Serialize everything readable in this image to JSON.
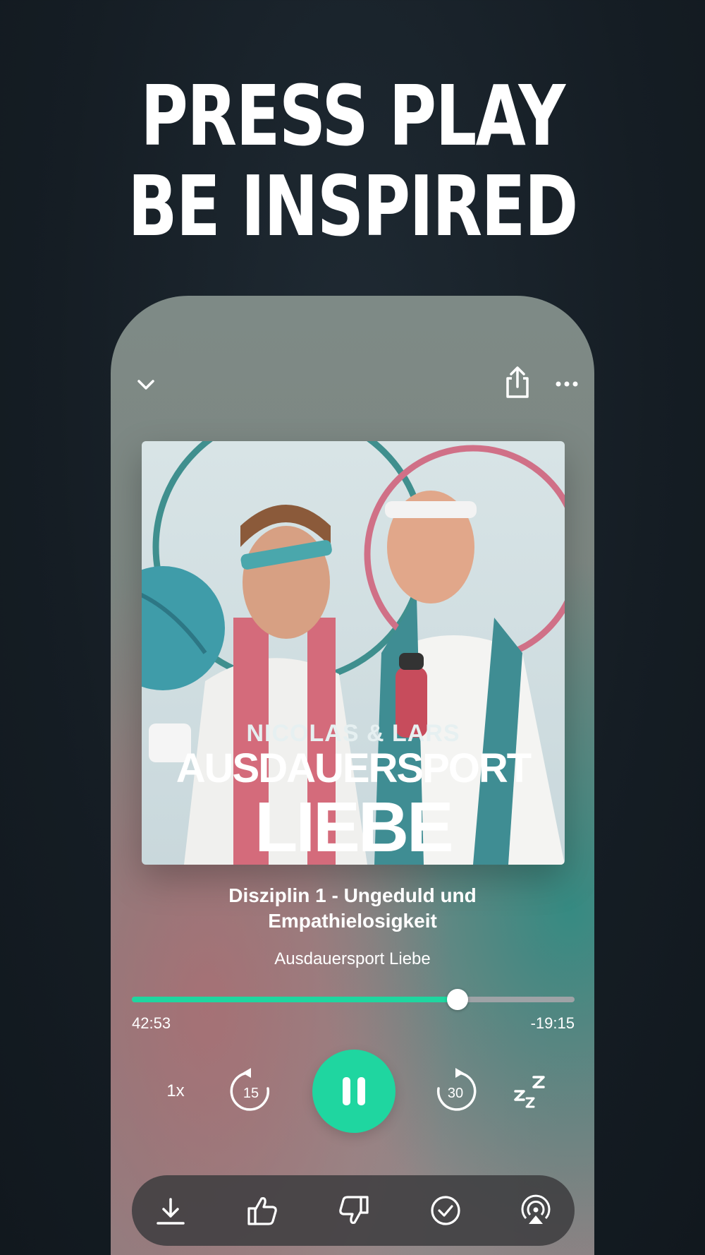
{
  "headline": {
    "line1": "PRESS PLAY",
    "line2": "BE INSPIRED"
  },
  "artwork": {
    "subtitle": "NICOLAS & LARS",
    "title_line1": "AUSDAUERSPORT",
    "title_line2": "LIEBE"
  },
  "episode": {
    "title_line1": "Disziplin 1 - Ungeduld und",
    "title_line2": "Empathielosigkeit",
    "show": "Ausdauersport Liebe"
  },
  "playback": {
    "elapsed": "42:53",
    "remaining": "-19:15",
    "progress_fraction": 0.735,
    "speed": "1x",
    "rewind_seconds": "15",
    "forward_seconds": "30"
  },
  "colors": {
    "accent": "#1fd6a0",
    "track": "#9ea3a6",
    "background": "#151d24"
  },
  "icons": {
    "collapse": "chevron-down-icon",
    "share": "share-icon",
    "more": "more-icon",
    "pause": "pause-icon",
    "sleep": "sleep-timer-icon",
    "download": "download-icon",
    "like": "thumbs-up-icon",
    "dislike": "thumbs-down-icon",
    "mark_played": "check-circle-icon",
    "cast": "airplay-icon"
  }
}
